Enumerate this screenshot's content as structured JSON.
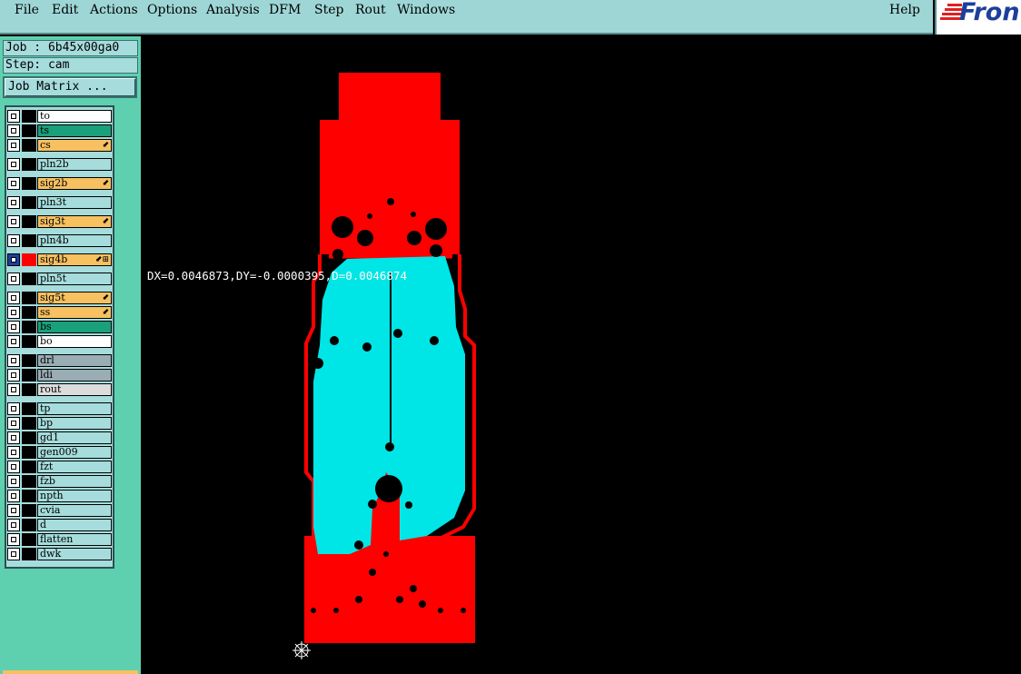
{
  "menu": {
    "items": [
      "File",
      "Edit",
      "Actions",
      "Options",
      "Analysis",
      "DFM",
      "Step",
      "Rout",
      "Windows"
    ],
    "help": "Help"
  },
  "logo": {
    "text": "Fron"
  },
  "job": {
    "label": "Job : 6b45x00ga0"
  },
  "step": {
    "label": "Step: cam"
  },
  "job_matrix": {
    "label": "Job Matrix ..."
  },
  "layers": [
    {
      "name": "to",
      "color": "#ffffff",
      "edit": false
    },
    {
      "name": "ts",
      "color": "#1aa07a",
      "edit": false
    },
    {
      "name": "cs",
      "color": "#f7c060",
      "edit": true
    },
    {
      "name": "pln2b",
      "color": "#a6dcdc",
      "edit": false
    },
    {
      "name": "sig2b",
      "color": "#f7c060",
      "edit": true
    },
    {
      "name": "pln3t",
      "color": "#a6dcdc",
      "edit": false
    },
    {
      "name": "sig3t",
      "color": "#f7c060",
      "edit": true
    },
    {
      "name": "pln4b",
      "color": "#a6dcdc",
      "edit": false
    },
    {
      "name": "sig4b",
      "color": "#f7c060",
      "edit": true,
      "active": true
    },
    {
      "name": "pln5t",
      "color": "#a6dcdc",
      "edit": false
    },
    {
      "name": "sig5t",
      "color": "#f7c060",
      "edit": true
    },
    {
      "name": "ss",
      "color": "#f7c060",
      "edit": true
    },
    {
      "name": "bs",
      "color": "#1aa07a",
      "edit": false
    },
    {
      "name": "bo",
      "color": "#ffffff",
      "edit": false
    },
    {
      "name": "drl",
      "color": "#9aacb4",
      "edit": false
    },
    {
      "name": "ldi",
      "color": "#9aacb4",
      "edit": false
    },
    {
      "name": "rout",
      "color": "#dcdcdc",
      "edit": false
    },
    {
      "name": "tp",
      "color": "#a6dcdc",
      "edit": false
    },
    {
      "name": "bp",
      "color": "#a6dcdc",
      "edit": false
    },
    {
      "name": "gd1",
      "color": "#a6dcdc",
      "edit": false
    },
    {
      "name": "gen009",
      "color": "#a6dcdc",
      "edit": false
    },
    {
      "name": "fzt",
      "color": "#a6dcdc",
      "edit": false
    },
    {
      "name": "fzb",
      "color": "#a6dcdc",
      "edit": false
    },
    {
      "name": "npth",
      "color": "#a6dcdc",
      "edit": false
    },
    {
      "name": "cvia",
      "color": "#a6dcdc",
      "edit": false
    },
    {
      "name": "d",
      "color": "#a6dcdc",
      "edit": false
    },
    {
      "name": "flatten",
      "color": "#a6dcdc",
      "edit": false
    },
    {
      "name": "dwk",
      "color": "#a6dcdc",
      "edit": false
    }
  ],
  "measurement": {
    "text": "DX=0.0046873,DY=-0.0000395,D=0.0046874"
  },
  "colors": {
    "copper": "#ff0000",
    "plane": "#00e5e5",
    "background": "#000000"
  }
}
